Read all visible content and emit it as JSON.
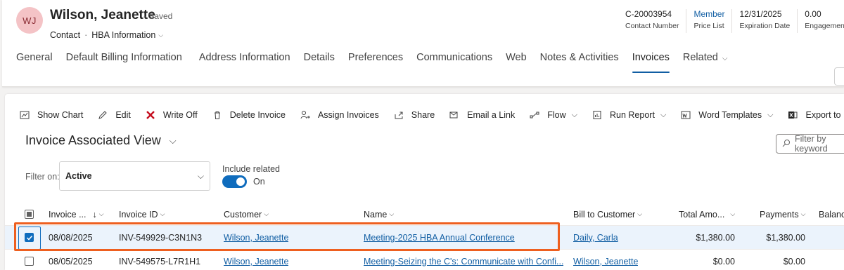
{
  "record": {
    "initials": "WJ",
    "name": "Wilson, Jeanette",
    "saved": "- Saved",
    "entity": "Contact",
    "separator": "·",
    "form": "HBA Information",
    "avatar_color": "#f4c3c6"
  },
  "header_fields": [
    {
      "value": "C-20003954",
      "label": "Contact Number",
      "is_link": false
    },
    {
      "value": "Member",
      "label": "Price List",
      "is_link": true
    },
    {
      "value": "12/31/2025",
      "label": "Expiration Date",
      "is_link": false
    },
    {
      "value": "0.00",
      "label": "Engagement",
      "is_link": false
    }
  ],
  "tabs": [
    {
      "label": "General"
    },
    {
      "label": "Default Billing Information"
    },
    {
      "label": "Address Information"
    },
    {
      "label": "Details"
    },
    {
      "label": "Preferences"
    },
    {
      "label": "Communications"
    },
    {
      "label": "Web"
    },
    {
      "label": "Notes & Activities"
    },
    {
      "label": "Invoices",
      "active": true
    },
    {
      "label": "Related",
      "dropdown": true
    }
  ],
  "commands": [
    {
      "label": "Show Chart",
      "icon": "chart-icon"
    },
    {
      "label": "Edit",
      "icon": "pencil-icon"
    },
    {
      "label": "Write Off",
      "icon": "x-mark-icon"
    },
    {
      "label": "Delete Invoice",
      "icon": "trash-icon"
    },
    {
      "label": "Assign Invoices",
      "icon": "person-arrow-icon"
    },
    {
      "label": "Share",
      "icon": "share-icon"
    },
    {
      "label": "Email a Link",
      "icon": "email-link-icon"
    },
    {
      "label": "Flow",
      "icon": "flow-icon",
      "dropdown": true
    },
    {
      "label": "Run Report",
      "icon": "report-icon",
      "dropdown": true
    },
    {
      "label": "Word Templates",
      "icon": "word-icon",
      "dropdown": true
    },
    {
      "label": "Export to Excel",
      "icon": "excel-icon"
    }
  ],
  "view": {
    "title": "Invoice Associated View",
    "filter_placeholder": "Filter by keyword",
    "filter_on_label": "Filter on:",
    "filter_on_value": "Active",
    "include_related_label": "Include related",
    "include_related_state": "On"
  },
  "grid": {
    "columns": [
      {
        "label": "Invoice ...",
        "sort": "↓"
      },
      {
        "label": "Invoice ID"
      },
      {
        "label": "Customer"
      },
      {
        "label": "Name"
      },
      {
        "label": "Bill to Customer"
      },
      {
        "label": "Total Amo..."
      },
      {
        "label": "Payments"
      },
      {
        "label": "Balance"
      }
    ],
    "rows": [
      {
        "selected": true,
        "invoice_date": "08/08/2025",
        "invoice_id": "INV-549929-C3N1N3",
        "customer": "Wilson, Jeanette",
        "name": "Meeting-2025 HBA Annual Conference",
        "bill_to": "Daily, Carla",
        "total": "$1,380.00",
        "payments": "$1,380.00"
      },
      {
        "selected": false,
        "invoice_date": "08/05/2025",
        "invoice_id": "INV-549575-L7R1H1",
        "customer": "Wilson, Jeanette",
        "name": "Meeting-Seizing the C's: Communicate with Confi...",
        "bill_to": "Wilson, Jeanette",
        "total": "$0.00",
        "payments": "$0.00"
      }
    ]
  },
  "colors": {
    "accent": "#0f6cbd",
    "link": "#115ea3",
    "highlight": "#ee5f1f",
    "selected_row": "#ebf3fc"
  }
}
